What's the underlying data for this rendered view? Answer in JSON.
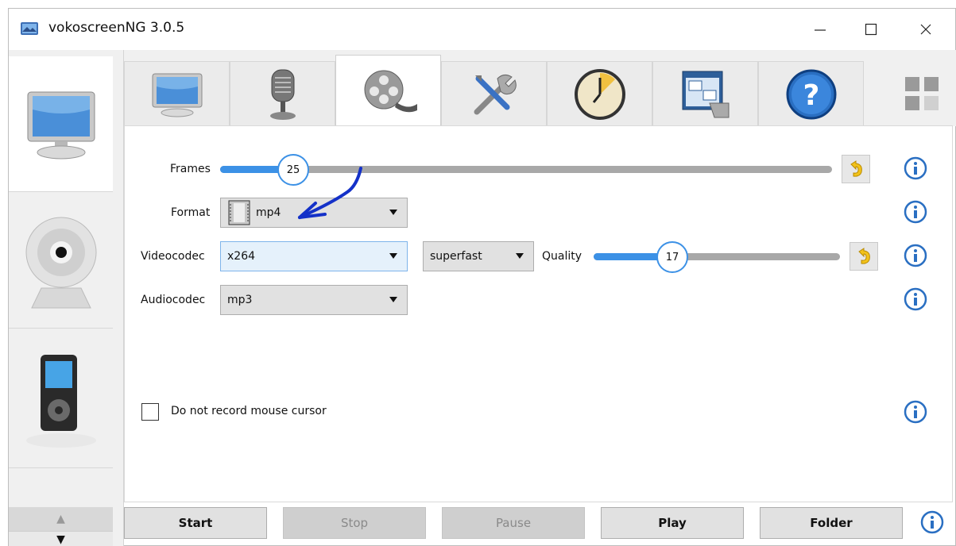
{
  "window": {
    "title": "vokoscreenNG 3.0.5"
  },
  "side_panel": {
    "items": [
      {
        "name": "screen",
        "icon": "monitor-icon"
      },
      {
        "name": "camera",
        "icon": "webcam-icon"
      },
      {
        "name": "player",
        "icon": "media-player-icon"
      }
    ]
  },
  "tabs": [
    {
      "icon": "monitor-icon"
    },
    {
      "icon": "microphone-icon"
    },
    {
      "icon": "film-reel-icon",
      "selected": true
    },
    {
      "icon": "tools-icon"
    },
    {
      "icon": "timer-icon"
    },
    {
      "icon": "window-move-icon"
    },
    {
      "icon": "help-icon"
    }
  ],
  "video": {
    "frames_label": "Frames",
    "frames_value": "25",
    "frames_fraction": 0.12,
    "format_label": "Format",
    "format_value": "mp4",
    "videocodec_label": "Videocodec",
    "videocodec_value": "x264",
    "preset_value": "superfast",
    "quality_label": "Quality",
    "quality_value": "17",
    "quality_fraction": 0.32,
    "audiocodec_label": "Audiocodec",
    "audiocodec_value": "mp3",
    "mouse_cursor_label": "Do not record mouse cursor"
  },
  "buttons": {
    "start": "Start",
    "stop": "Stop",
    "pause": "Pause",
    "play": "Play",
    "folder": "Folder"
  },
  "colors": {
    "accent": "#3c91e6",
    "annotation": "#1431c8"
  }
}
